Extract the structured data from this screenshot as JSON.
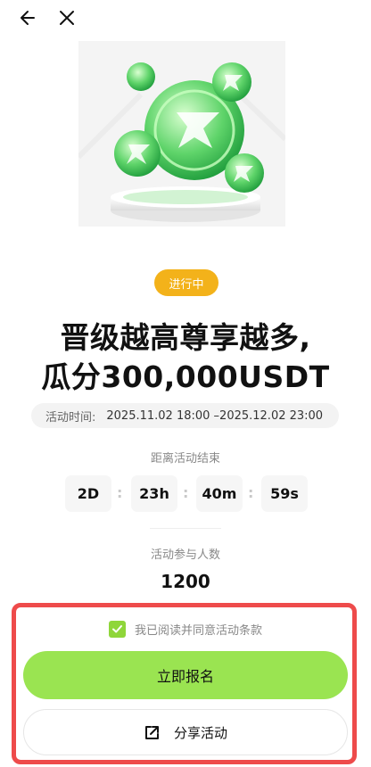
{
  "nav": {
    "back_icon": "arrow-left-icon",
    "close_icon": "close-icon"
  },
  "hero": {
    "image": "green-coin-trophy-illustration"
  },
  "status": {
    "label": "进行中",
    "color": "#f3b21a"
  },
  "title": {
    "line1": "晋级越高尊享越多,",
    "line2": "瓜分300,000USDT"
  },
  "time": {
    "label": "活动时间:",
    "range": "2025.11.02 18:00 –2025.12.02 23:00"
  },
  "countdown": {
    "label": "距离活动结束",
    "days": "2D",
    "hours": "23h",
    "minutes": "40m",
    "seconds": "59s",
    "separator": ":"
  },
  "participants": {
    "label": "活动参与人数",
    "count": "1200"
  },
  "agreement": {
    "checked": true,
    "text": "我已阅读并同意活动条款"
  },
  "actions": {
    "register_label": "立即报名",
    "share_label": "分享活动",
    "share_icon": "external-share-icon"
  },
  "colors": {
    "accent": "#9ae451",
    "highlight_border": "#ee4b4b"
  }
}
